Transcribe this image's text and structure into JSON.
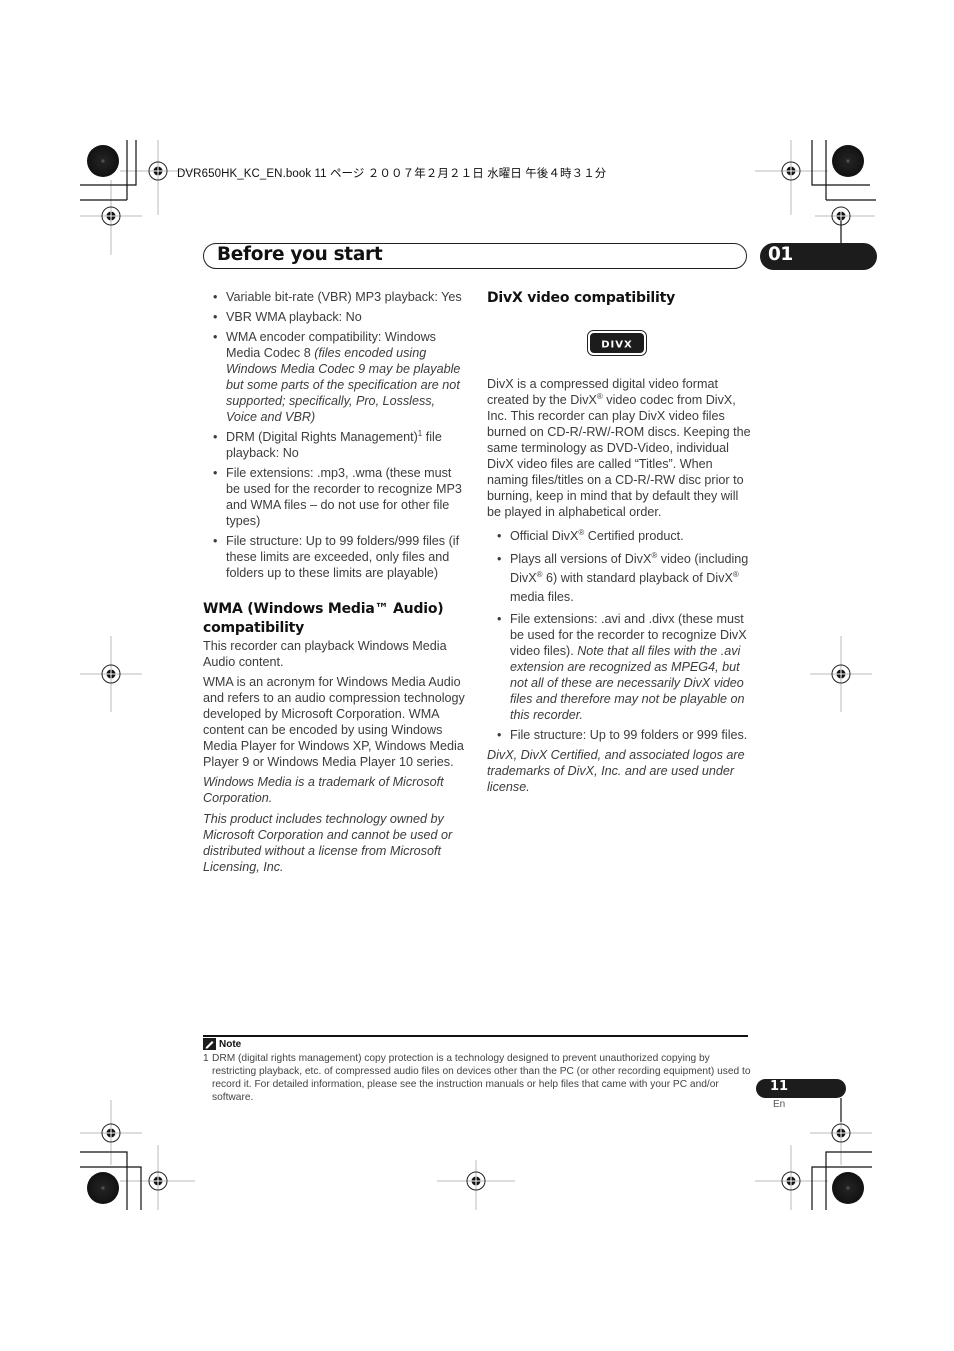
{
  "print_header": "DVR650HK_KC_EN.book  11 ページ  ２００７年２月２１日  水曜日  午後４時３１分",
  "header": {
    "title": "Before you start",
    "chapter": "01"
  },
  "left_column": {
    "bullets": [
      {
        "text": "Variable bit-rate (VBR) MP3 playback: Yes"
      },
      {
        "text": "VBR WMA playback: No"
      },
      {
        "text": "WMA encoder compatibility: Windows Media Codec 8 ",
        "italic": "(files encoded using Windows Media Codec 9 may be playable but some parts of the specification are not supported; specifically, Pro, Lossless, Voice and VBR)"
      },
      {
        "text_before": "DRM (Digital Rights Management)",
        "sup": "1",
        "text_after": " file playback: No"
      },
      {
        "text": "File extensions: .mp3, .wma (these must be used for the recorder to recognize MP3 and WMA files – do not use for other file types)"
      },
      {
        "text": "File structure: Up to 99 folders/999 files (if these limits are exceeded, only files and folders up to these limits are playable)"
      }
    ],
    "wma_heading": "WMA (Windows Media™ Audio) compatibility",
    "wma_paragraphs": [
      "This recorder can playback Windows Media Audio content.",
      "WMA is an acronym for Windows Media Audio and refers to an audio compression technology developed by Microsoft Corporation. WMA content can be encoded by using Windows Media Player for Windows XP, Windows Media Player 9 or Windows Media Player 10 series."
    ],
    "wma_notices": [
      "Windows Media is a trademark of Microsoft Corporation.",
      "This product includes technology owned by Microsoft Corporation and cannot be used or distributed without a license from Microsoft Licensing, Inc."
    ]
  },
  "right_column": {
    "heading": "DivX video compatibility",
    "logo_text": "DIVX",
    "intro": {
      "p1": "DivX is a compressed digital video format created by the DivX",
      "reg": "®",
      "p2": " video codec from DivX, Inc. This recorder can play DivX video files burned on CD-R/-RW/-ROM discs. Keeping the same terminology as DVD-Video, individual DivX video files are called “Titles”. When naming files/titles on a CD-R/-RW disc prior to burning, keep in mind that by default they will be played in alphabetical order."
    },
    "bullets": {
      "b1_a": "Official DivX",
      "b1_b": " Certified product.",
      "b2_a": "Plays all versions of DivX",
      "b2_b": " video (including DivX",
      "b2_c": " 6) with standard playback of DivX",
      "b2_d": " media files.",
      "b3_text": "File extensions: .avi and .divx (these must be used for the recorder to recognize DivX video files). ",
      "b3_italic": "Note that all files with the .avi extension are recognized as MPEG4, but not all of these are necessarily DivX video files and therefore may not be playable on this recorder.",
      "b4": "File structure: Up to 99 folders or 999 files."
    },
    "notice": "DivX, DivX Certified, and associated logos are trademarks of DivX, Inc. and are used under license."
  },
  "note": {
    "label": "Note",
    "number": "1",
    "text": "DRM (digital rights management) copy protection is a technology designed to prevent unauthorized copying by restricting playback, etc. of compressed audio files on devices other than the PC (or other recording equipment) used to record it. For detailed information, please see the instruction manuals or help files that came with your PC and/or software."
  },
  "footer": {
    "page_number": "11",
    "language": "En"
  }
}
